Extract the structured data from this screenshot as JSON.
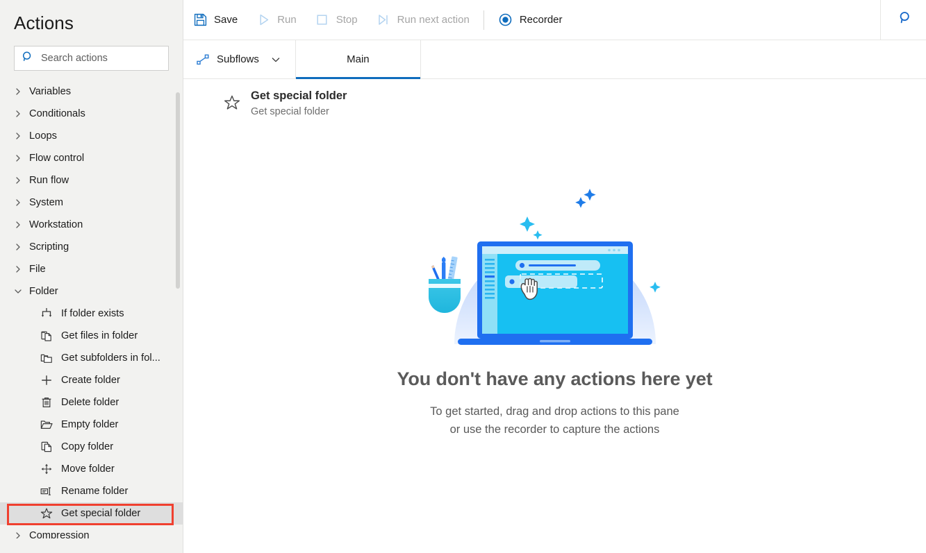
{
  "sidebar": {
    "title": "Actions",
    "search": {
      "placeholder": "Search actions",
      "value": "",
      "icon": "search-icon"
    },
    "tree": [
      {
        "type": "group",
        "label": "Variables",
        "expanded": false,
        "icon": "chevron-right-icon"
      },
      {
        "type": "group",
        "label": "Conditionals",
        "expanded": false,
        "icon": "chevron-right-icon"
      },
      {
        "type": "group",
        "label": "Loops",
        "expanded": false,
        "icon": "chevron-right-icon"
      },
      {
        "type": "group",
        "label": "Flow control",
        "expanded": false,
        "icon": "chevron-right-icon"
      },
      {
        "type": "group",
        "label": "Run flow",
        "expanded": false,
        "icon": "chevron-right-icon"
      },
      {
        "type": "group",
        "label": "System",
        "expanded": false,
        "icon": "chevron-right-icon"
      },
      {
        "type": "group",
        "label": "Workstation",
        "expanded": false,
        "icon": "chevron-right-icon"
      },
      {
        "type": "group",
        "label": "Scripting",
        "expanded": false,
        "icon": "chevron-right-icon"
      },
      {
        "type": "group",
        "label": "File",
        "expanded": false,
        "icon": "chevron-right-icon"
      },
      {
        "type": "group",
        "label": "Folder",
        "expanded": true,
        "icon": "chevron-down-icon"
      },
      {
        "type": "leaf",
        "label": "If folder exists",
        "icon": "branch-arrows-icon"
      },
      {
        "type": "leaf",
        "label": "Get files in folder",
        "icon": "copy-files-icon"
      },
      {
        "type": "leaf",
        "label": "Get subfolders in fol...",
        "icon": "folders-icon"
      },
      {
        "type": "leaf",
        "label": "Create folder",
        "icon": "plus-icon"
      },
      {
        "type": "leaf",
        "label": "Delete folder",
        "icon": "trash-icon"
      },
      {
        "type": "leaf",
        "label": "Empty folder",
        "icon": "open-folder-icon"
      },
      {
        "type": "leaf",
        "label": "Copy folder",
        "icon": "copy-icon"
      },
      {
        "type": "leaf",
        "label": "Move folder",
        "icon": "move-arrows-icon"
      },
      {
        "type": "leaf",
        "label": "Rename folder",
        "icon": "rename-icon",
        "selected": true
      },
      {
        "type": "leaf",
        "label": "Get special folder",
        "icon": "star-icon",
        "selected": true
      },
      {
        "type": "group",
        "label": "Compression",
        "expanded": false,
        "icon": "chevron-right-icon"
      }
    ],
    "selected_item": "Get special folder",
    "highlight_color": "#f0402f"
  },
  "toolbar": {
    "buttons": [
      {
        "label": "Save",
        "icon": "save-icon",
        "enabled": true
      },
      {
        "label": "Run",
        "icon": "play-icon",
        "enabled": false
      },
      {
        "label": "Stop",
        "icon": "stop-icon",
        "enabled": false
      },
      {
        "label": "Run next action",
        "icon": "step-over-icon",
        "enabled": false
      },
      {
        "label": "Recorder",
        "icon": "record-icon",
        "enabled": true
      }
    ],
    "search_icon": "search-icon",
    "accent_color": "#0f6cbd"
  },
  "tabbar": {
    "subflows": {
      "label": "Subflows",
      "icon": "subflow-icon",
      "chevron": "chevron-down-icon"
    },
    "tabs": [
      {
        "label": "Main",
        "active": true
      }
    ]
  },
  "canvas": {
    "drag_item": {
      "title": "Get special folder",
      "subtitle": "Get special folder",
      "icon": "star-icon",
      "cursor": "drag-copy-cursor"
    },
    "empty_state": {
      "illustration": "drag-and-drop-laptop-illustration",
      "title": "You don't have any actions here yet",
      "subtitle_line1": "To get started, drag and drop actions to this pane",
      "subtitle_line2": "or use the recorder to capture the actions"
    }
  }
}
